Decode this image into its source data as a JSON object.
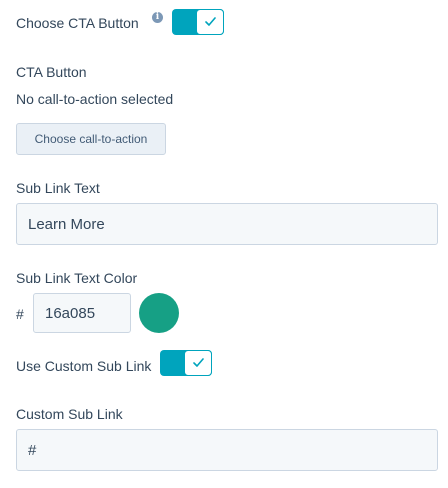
{
  "cta_toggle": {
    "label": "Choose CTA Button",
    "info_icon": "info-icon",
    "info_glyph": "i",
    "enabled": true
  },
  "cta_button": {
    "heading": "CTA Button",
    "status_text": "No call-to-action selected",
    "choose_button_label": "Choose call-to-action"
  },
  "sub_link_text": {
    "label": "Sub Link Text",
    "value": "Learn More"
  },
  "sub_link_color": {
    "label": "Sub Link Text Color",
    "hash_prefix": "#",
    "value": "16a085",
    "swatch_color": "#16a085"
  },
  "custom_sub_link_toggle": {
    "label": "Use Custom Sub Link",
    "enabled": true
  },
  "custom_sub_link": {
    "label": "Custom Sub Link",
    "value": "#"
  },
  "colors": {
    "toggle_accent": "#00a4bd",
    "text": "#33475b"
  }
}
